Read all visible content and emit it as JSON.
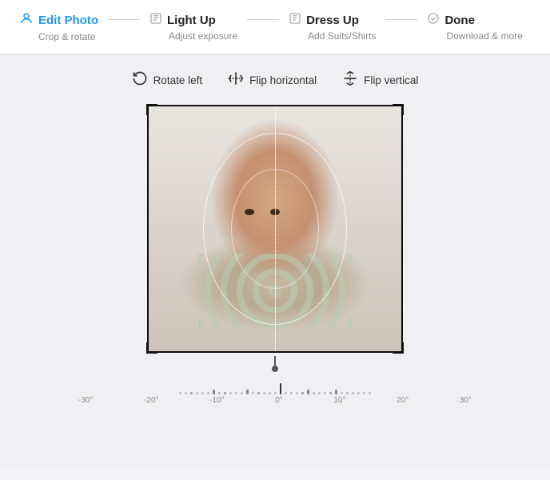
{
  "header": {
    "steps": [
      {
        "id": "edit-photo",
        "title": "Edit Photo",
        "subtitle": "Crop & rotate",
        "active": true,
        "icon": "person-icon"
      },
      {
        "id": "light-up",
        "title": "Light Up",
        "subtitle": "Adjust exposure",
        "active": false,
        "icon": "sun-icon"
      },
      {
        "id": "dress-up",
        "title": "Dress Up",
        "subtitle": "Add Suits/Shirts",
        "active": false,
        "icon": "shirt-icon"
      },
      {
        "id": "done",
        "title": "Done",
        "subtitle": "Download & more",
        "active": false,
        "icon": "check-icon"
      }
    ]
  },
  "toolbar": {
    "buttons": [
      {
        "id": "rotate-left",
        "label": "Rotate left",
        "icon": "↺"
      },
      {
        "id": "flip-horizontal",
        "label": "Flip horizontal",
        "icon": "⬡"
      },
      {
        "id": "flip-vertical",
        "label": "Flip vertical",
        "icon": "▷"
      }
    ]
  },
  "ruler": {
    "labels": [
      "-30°",
      "-20°",
      "-10°",
      "0°",
      "10°",
      "20°",
      "30°"
    ],
    "current_angle": "0°"
  }
}
